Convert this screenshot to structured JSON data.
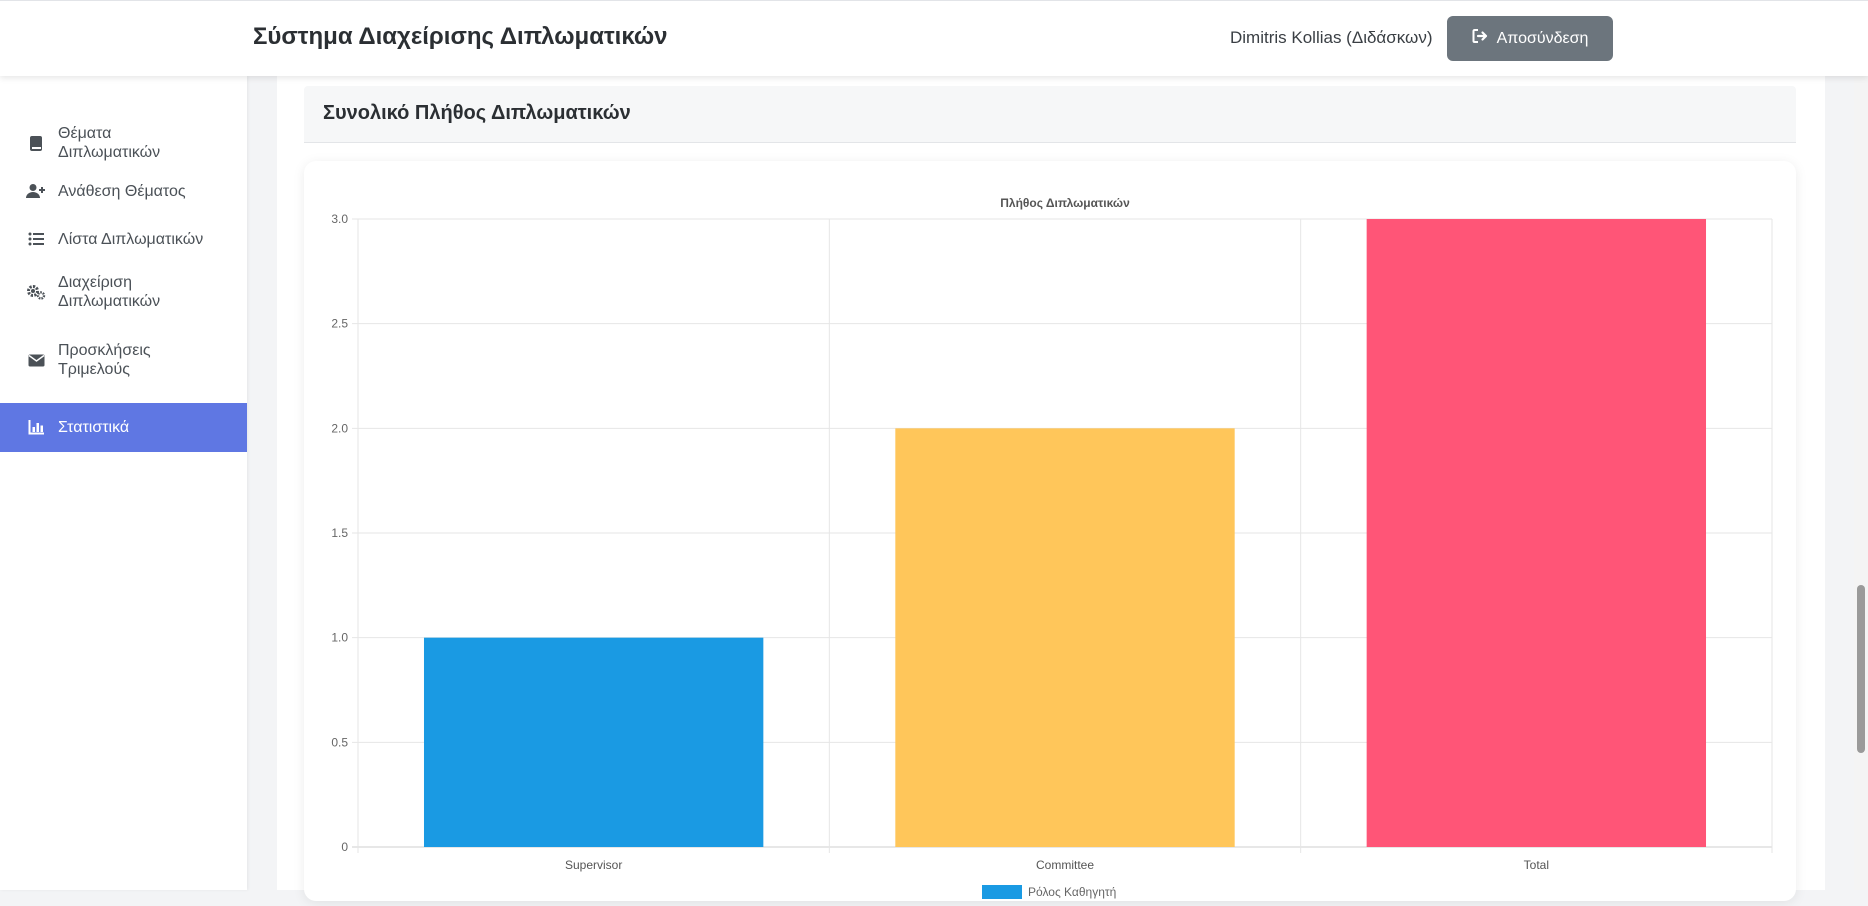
{
  "header": {
    "app_title": "Σύστημα Διαχείρισης Διπλωματικών",
    "user": "Dimitris Kollias (Διδάσκων)",
    "logout_label": "Αποσύνδεση"
  },
  "sidebar": {
    "items": [
      {
        "label_lines": [
          "Θέματα",
          "Διπλωματικών"
        ],
        "icon": "book-icon",
        "active": false
      },
      {
        "label_lines": [
          "Ανάθεση Θέματος"
        ],
        "icon": "user-plus-icon",
        "active": false
      },
      {
        "label_lines": [
          "Λίστα Διπλωματικών"
        ],
        "icon": "list-icon",
        "active": false
      },
      {
        "label_lines": [
          "Διαχείριση",
          "Διπλωματικών"
        ],
        "icon": "gears-icon",
        "active": false
      },
      {
        "label_lines": [
          "Προσκλήσεις",
          "Τριμελούς"
        ],
        "icon": "envelope-icon",
        "active": false
      },
      {
        "label_lines": [
          "Στατιστικά"
        ],
        "icon": "chart-icon",
        "active": true
      }
    ]
  },
  "section": {
    "title": "Συνολικό Πλήθος Διπλωματικών"
  },
  "colors": {
    "accent": "#5f77e3",
    "supervisor": "#1a9ae3",
    "committee": "#ffc65a",
    "total": "#ff5577"
  },
  "chart_data": {
    "type": "bar",
    "title": "Πλήθος Διπλωματικών",
    "categories": [
      "Supervisor",
      "Committee",
      "Total"
    ],
    "values": [
      1,
      2,
      3
    ],
    "bar_colors": [
      "#1a9ae3",
      "#ffc65a",
      "#ff5577"
    ],
    "ylim": [
      0,
      3
    ],
    "yticks": [
      "0",
      "0.5",
      "1.0",
      "1.5",
      "2.0",
      "2.5",
      "3.0"
    ],
    "grid": true,
    "legend_position": "bottom",
    "legend_text": "Ρόλος Καθηγητή"
  }
}
